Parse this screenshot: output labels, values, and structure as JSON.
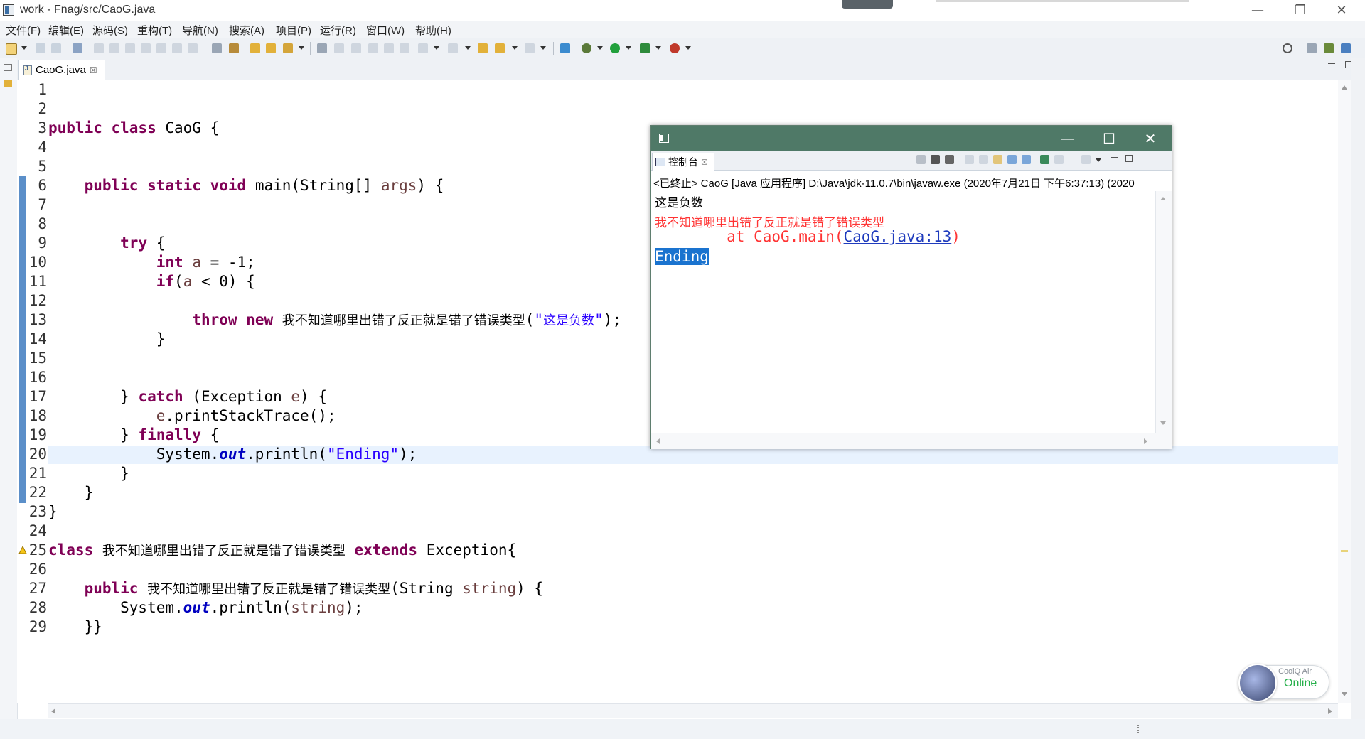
{
  "window": {
    "title": "work - Fnag/src/CaoG.java",
    "minimize_glyph": "—",
    "restore_glyph": "❐",
    "close_glyph": "✕"
  },
  "menu": [
    "文件(F)",
    "编辑(E)",
    "源码(S)",
    "重构(T)",
    "导航(N)",
    "搜索(A)",
    "项目(P)",
    "运行(R)",
    "窗口(W)",
    "帮助(H)"
  ],
  "editor": {
    "tab_label": "CaoG.java",
    "tab_close": "☒",
    "class_name": "我不知道哪里出错了反正就是错了错误类型",
    "message": "这是负数"
  },
  "console": {
    "tab_label": "控制台",
    "tab_close": "☒",
    "header": "<已终止> CaoG [Java 应用程序] D:\\Java\\jdk-11.0.7\\bin\\javaw.exe  (2020年7月21日 下午6:37:13)  (2020",
    "line1": "这是负数",
    "line2": "我不知道哪里出错了反正就是错了错误类型",
    "trace_prefix": "        at CaoG.main(",
    "trace_link": "CaoG.java:13",
    "trace_suffix": ")",
    "line4": "Ending",
    "minimize_glyph": "—",
    "maximize_glyph": "☐",
    "close_glyph": "✕"
  },
  "widget": {
    "name": "CoolQ Air",
    "status": "Online"
  },
  "colors": {
    "keyword": "#7f0055",
    "string": "#2a00ff",
    "error": "#ff3333",
    "console_titlebar": "#4f7967",
    "selection": "#1a73cf",
    "online": "#27b04b"
  }
}
